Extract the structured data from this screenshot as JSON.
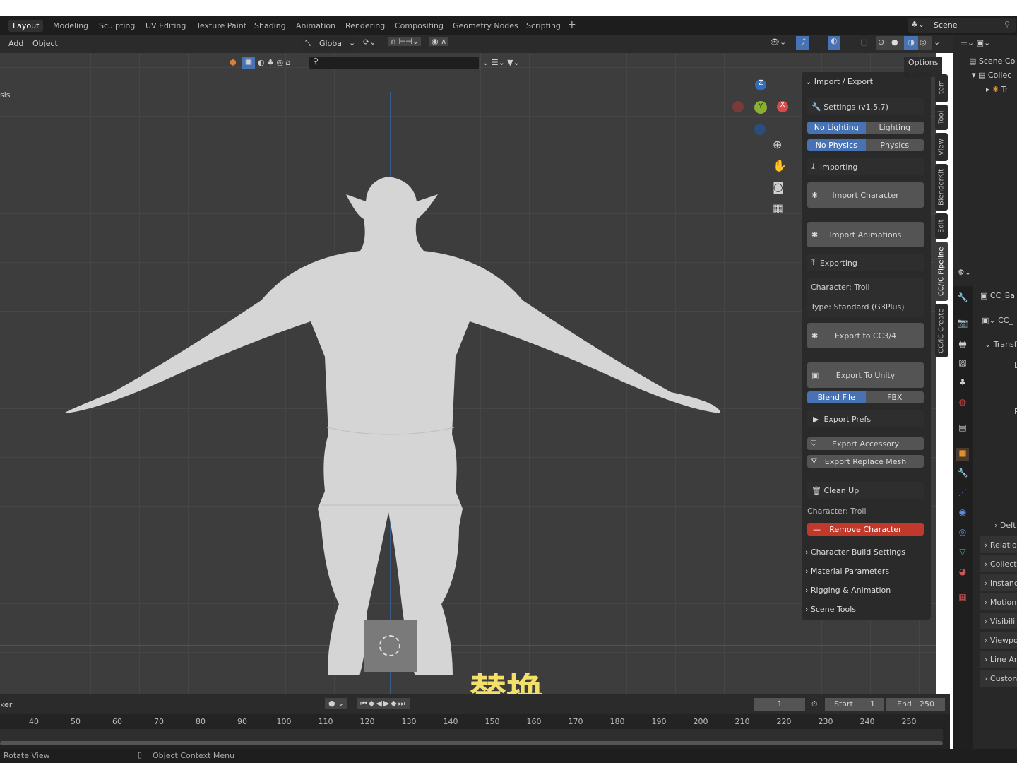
{
  "workspaces": [
    "Layout",
    "Modeling",
    "Sculpting",
    "UV Editing",
    "Texture Paint",
    "Shading",
    "Animation",
    "Rendering",
    "Compositing",
    "Geometry Nodes",
    "Scripting",
    "+"
  ],
  "scene": "Scene",
  "header": {
    "menus": [
      "Add",
      "Object"
    ],
    "transform_orientation": "Global",
    "options": "Options",
    "left_text": "sis"
  },
  "npanel": {
    "section": "Import / Export",
    "settings": "Settings  (v1.5.7)",
    "lighting": [
      "No Lighting",
      "Lighting"
    ],
    "physics": [
      "No Physics",
      "Physics"
    ],
    "importing": "Importing",
    "import_character": "Import Character",
    "import_animations": "Import Animations",
    "exporting": "Exporting",
    "character": "Character: Troll",
    "type": "Type: Standard (G3Plus)",
    "export_cc": "Export to CC3/4",
    "export_unity": "Export To Unity",
    "format": [
      "Blend File",
      "FBX"
    ],
    "export_prefs": "Export Prefs",
    "export_accessory": "Export Accessory",
    "export_replace": "Export Replace Mesh",
    "clean_up": "Clean Up",
    "character2": "Character: Troll",
    "remove": "Remove Character",
    "subpanels": [
      "Character Build Settings",
      "Material Parameters",
      "Rigging & Animation",
      "Scene Tools"
    ]
  },
  "vtabs": [
    "Item",
    "Tool",
    "View",
    "BlenderKit",
    "Edit",
    "CC/iC Pipeline",
    "CC/iC Create"
  ],
  "outliner": [
    "Scene Co",
    "Collec",
    "Tr"
  ],
  "properties": {
    "object": "CC_Ba",
    "data": "CC_",
    "transform": "Transfo",
    "l": "L",
    "r": "R",
    "delta": "Delt",
    "panels": [
      "Relatio",
      "Collect",
      "Instanc",
      "Motion",
      "Visibili",
      "Viewpo",
      "Line Ar",
      "Custon"
    ]
  },
  "gizmo": {
    "z": "Z",
    "y": "Y",
    "x": "X"
  },
  "subtitle": "替换",
  "timeline": {
    "left_text": "ker",
    "current": "1",
    "start_label": "Start",
    "start": "1",
    "end_label": "End",
    "end": "250",
    "ticks": [
      "40",
      "50",
      "60",
      "70",
      "80",
      "90",
      "100",
      "110",
      "120",
      "130",
      "140",
      "150",
      "160",
      "170",
      "180",
      "190",
      "200",
      "210",
      "220",
      "230",
      "240",
      "250"
    ]
  },
  "status": {
    "left": "Rotate View",
    "middle": "Object Context Menu"
  }
}
